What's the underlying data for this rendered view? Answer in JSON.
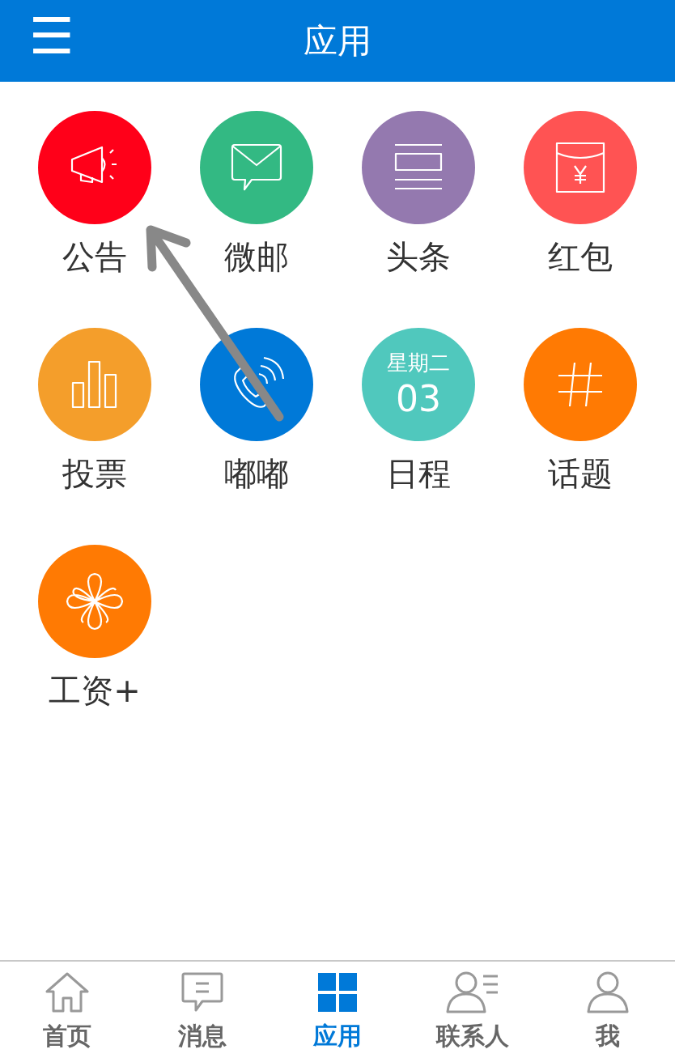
{
  "header": {
    "menu_icon": "☰",
    "title": "应用"
  },
  "apps": [
    {
      "label": "公告",
      "kind": "megaphone",
      "color": "#ff0019"
    },
    {
      "label": "微邮",
      "kind": "mail",
      "color": "#33b983"
    },
    {
      "label": "头条",
      "kind": "news",
      "color": "#9479af"
    },
    {
      "label": "红包",
      "kind": "envelope",
      "color": "#ff5353"
    },
    {
      "label": "投票",
      "kind": "bars",
      "color": "#f49e2b"
    },
    {
      "label": "嘟嘟",
      "kind": "phone",
      "color": "#0079d8"
    },
    {
      "label": "日程",
      "kind": "calendar",
      "color": "#50c8bd",
      "weekday": "星期二",
      "day": "03"
    },
    {
      "label": "话题",
      "kind": "hash",
      "color": "#ff7a03"
    },
    {
      "label": "工资+",
      "kind": "flower",
      "color": "#ff7a03"
    }
  ],
  "tabs": [
    {
      "label": "首页",
      "kind": "home",
      "selected": false
    },
    {
      "label": "消息",
      "kind": "chat",
      "selected": false
    },
    {
      "label": "应用",
      "kind": "grid",
      "selected": true
    },
    {
      "label": "联系人",
      "kind": "contacts",
      "selected": false
    },
    {
      "label": "我",
      "kind": "person",
      "selected": false
    }
  ]
}
